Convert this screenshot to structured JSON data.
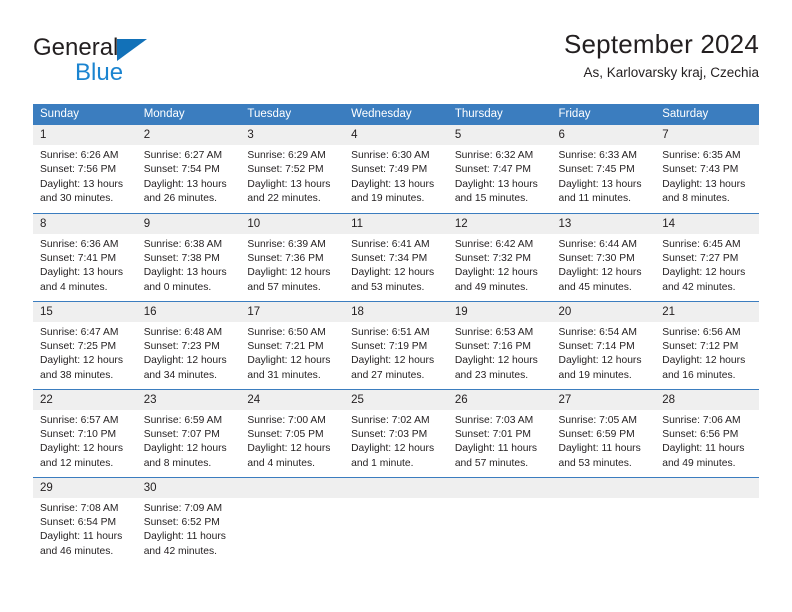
{
  "logo": {
    "line1": "General",
    "line2": "Blue",
    "triangle_color": "#1271b8",
    "text_color": "#231f20",
    "blue_text_color": "#1b84d0"
  },
  "header": {
    "title": "September 2024",
    "subtitle": "As, Karlovarsky kraj, Czechia"
  },
  "colors": {
    "header_bg": "#3b7dbf",
    "header_text": "#ffffff",
    "daynum_bg": "#efefef",
    "cell_bg": "#ffffff",
    "rule": "#3b7dbf",
    "body_text": "#231f20"
  },
  "calendar": {
    "weekday_headers": [
      "Sunday",
      "Monday",
      "Tuesday",
      "Wednesday",
      "Thursday",
      "Friday",
      "Saturday"
    ],
    "weeks": [
      [
        {
          "day": "1",
          "sunrise": "Sunrise: 6:26 AM",
          "sunset": "Sunset: 7:56 PM",
          "daylight1": "Daylight: 13 hours",
          "daylight2": "and 30 minutes."
        },
        {
          "day": "2",
          "sunrise": "Sunrise: 6:27 AM",
          "sunset": "Sunset: 7:54 PM",
          "daylight1": "Daylight: 13 hours",
          "daylight2": "and 26 minutes."
        },
        {
          "day": "3",
          "sunrise": "Sunrise: 6:29 AM",
          "sunset": "Sunset: 7:52 PM",
          "daylight1": "Daylight: 13 hours",
          "daylight2": "and 22 minutes."
        },
        {
          "day": "4",
          "sunrise": "Sunrise: 6:30 AM",
          "sunset": "Sunset: 7:49 PM",
          "daylight1": "Daylight: 13 hours",
          "daylight2": "and 19 minutes."
        },
        {
          "day": "5",
          "sunrise": "Sunrise: 6:32 AM",
          "sunset": "Sunset: 7:47 PM",
          "daylight1": "Daylight: 13 hours",
          "daylight2": "and 15 minutes."
        },
        {
          "day": "6",
          "sunrise": "Sunrise: 6:33 AM",
          "sunset": "Sunset: 7:45 PM",
          "daylight1": "Daylight: 13 hours",
          "daylight2": "and 11 minutes."
        },
        {
          "day": "7",
          "sunrise": "Sunrise: 6:35 AM",
          "sunset": "Sunset: 7:43 PM",
          "daylight1": "Daylight: 13 hours",
          "daylight2": "and 8 minutes."
        }
      ],
      [
        {
          "day": "8",
          "sunrise": "Sunrise: 6:36 AM",
          "sunset": "Sunset: 7:41 PM",
          "daylight1": "Daylight: 13 hours",
          "daylight2": "and 4 minutes."
        },
        {
          "day": "9",
          "sunrise": "Sunrise: 6:38 AM",
          "sunset": "Sunset: 7:38 PM",
          "daylight1": "Daylight: 13 hours",
          "daylight2": "and 0 minutes."
        },
        {
          "day": "10",
          "sunrise": "Sunrise: 6:39 AM",
          "sunset": "Sunset: 7:36 PM",
          "daylight1": "Daylight: 12 hours",
          "daylight2": "and 57 minutes."
        },
        {
          "day": "11",
          "sunrise": "Sunrise: 6:41 AM",
          "sunset": "Sunset: 7:34 PM",
          "daylight1": "Daylight: 12 hours",
          "daylight2": "and 53 minutes."
        },
        {
          "day": "12",
          "sunrise": "Sunrise: 6:42 AM",
          "sunset": "Sunset: 7:32 PM",
          "daylight1": "Daylight: 12 hours",
          "daylight2": "and 49 minutes."
        },
        {
          "day": "13",
          "sunrise": "Sunrise: 6:44 AM",
          "sunset": "Sunset: 7:30 PM",
          "daylight1": "Daylight: 12 hours",
          "daylight2": "and 45 minutes."
        },
        {
          "day": "14",
          "sunrise": "Sunrise: 6:45 AM",
          "sunset": "Sunset: 7:27 PM",
          "daylight1": "Daylight: 12 hours",
          "daylight2": "and 42 minutes."
        }
      ],
      [
        {
          "day": "15",
          "sunrise": "Sunrise: 6:47 AM",
          "sunset": "Sunset: 7:25 PM",
          "daylight1": "Daylight: 12 hours",
          "daylight2": "and 38 minutes."
        },
        {
          "day": "16",
          "sunrise": "Sunrise: 6:48 AM",
          "sunset": "Sunset: 7:23 PM",
          "daylight1": "Daylight: 12 hours",
          "daylight2": "and 34 minutes."
        },
        {
          "day": "17",
          "sunrise": "Sunrise: 6:50 AM",
          "sunset": "Sunset: 7:21 PM",
          "daylight1": "Daylight: 12 hours",
          "daylight2": "and 31 minutes."
        },
        {
          "day": "18",
          "sunrise": "Sunrise: 6:51 AM",
          "sunset": "Sunset: 7:19 PM",
          "daylight1": "Daylight: 12 hours",
          "daylight2": "and 27 minutes."
        },
        {
          "day": "19",
          "sunrise": "Sunrise: 6:53 AM",
          "sunset": "Sunset: 7:16 PM",
          "daylight1": "Daylight: 12 hours",
          "daylight2": "and 23 minutes."
        },
        {
          "day": "20",
          "sunrise": "Sunrise: 6:54 AM",
          "sunset": "Sunset: 7:14 PM",
          "daylight1": "Daylight: 12 hours",
          "daylight2": "and 19 minutes."
        },
        {
          "day": "21",
          "sunrise": "Sunrise: 6:56 AM",
          "sunset": "Sunset: 7:12 PM",
          "daylight1": "Daylight: 12 hours",
          "daylight2": "and 16 minutes."
        }
      ],
      [
        {
          "day": "22",
          "sunrise": "Sunrise: 6:57 AM",
          "sunset": "Sunset: 7:10 PM",
          "daylight1": "Daylight: 12 hours",
          "daylight2": "and 12 minutes."
        },
        {
          "day": "23",
          "sunrise": "Sunrise: 6:59 AM",
          "sunset": "Sunset: 7:07 PM",
          "daylight1": "Daylight: 12 hours",
          "daylight2": "and 8 minutes."
        },
        {
          "day": "24",
          "sunrise": "Sunrise: 7:00 AM",
          "sunset": "Sunset: 7:05 PM",
          "daylight1": "Daylight: 12 hours",
          "daylight2": "and 4 minutes."
        },
        {
          "day": "25",
          "sunrise": "Sunrise: 7:02 AM",
          "sunset": "Sunset: 7:03 PM",
          "daylight1": "Daylight: 12 hours",
          "daylight2": "and 1 minute."
        },
        {
          "day": "26",
          "sunrise": "Sunrise: 7:03 AM",
          "sunset": "Sunset: 7:01 PM",
          "daylight1": "Daylight: 11 hours",
          "daylight2": "and 57 minutes."
        },
        {
          "day": "27",
          "sunrise": "Sunrise: 7:05 AM",
          "sunset": "Sunset: 6:59 PM",
          "daylight1": "Daylight: 11 hours",
          "daylight2": "and 53 minutes."
        },
        {
          "day": "28",
          "sunrise": "Sunrise: 7:06 AM",
          "sunset": "Sunset: 6:56 PM",
          "daylight1": "Daylight: 11 hours",
          "daylight2": "and 49 minutes."
        }
      ],
      [
        {
          "day": "29",
          "sunrise": "Sunrise: 7:08 AM",
          "sunset": "Sunset: 6:54 PM",
          "daylight1": "Daylight: 11 hours",
          "daylight2": "and 46 minutes."
        },
        {
          "day": "30",
          "sunrise": "Sunrise: 7:09 AM",
          "sunset": "Sunset: 6:52 PM",
          "daylight1": "Daylight: 11 hours",
          "daylight2": "and 42 minutes."
        },
        {
          "day": "",
          "sunrise": "",
          "sunset": "",
          "daylight1": "",
          "daylight2": ""
        },
        {
          "day": "",
          "sunrise": "",
          "sunset": "",
          "daylight1": "",
          "daylight2": ""
        },
        {
          "day": "",
          "sunrise": "",
          "sunset": "",
          "daylight1": "",
          "daylight2": ""
        },
        {
          "day": "",
          "sunrise": "",
          "sunset": "",
          "daylight1": "",
          "daylight2": ""
        },
        {
          "day": "",
          "sunrise": "",
          "sunset": "",
          "daylight1": "",
          "daylight2": ""
        }
      ]
    ]
  }
}
